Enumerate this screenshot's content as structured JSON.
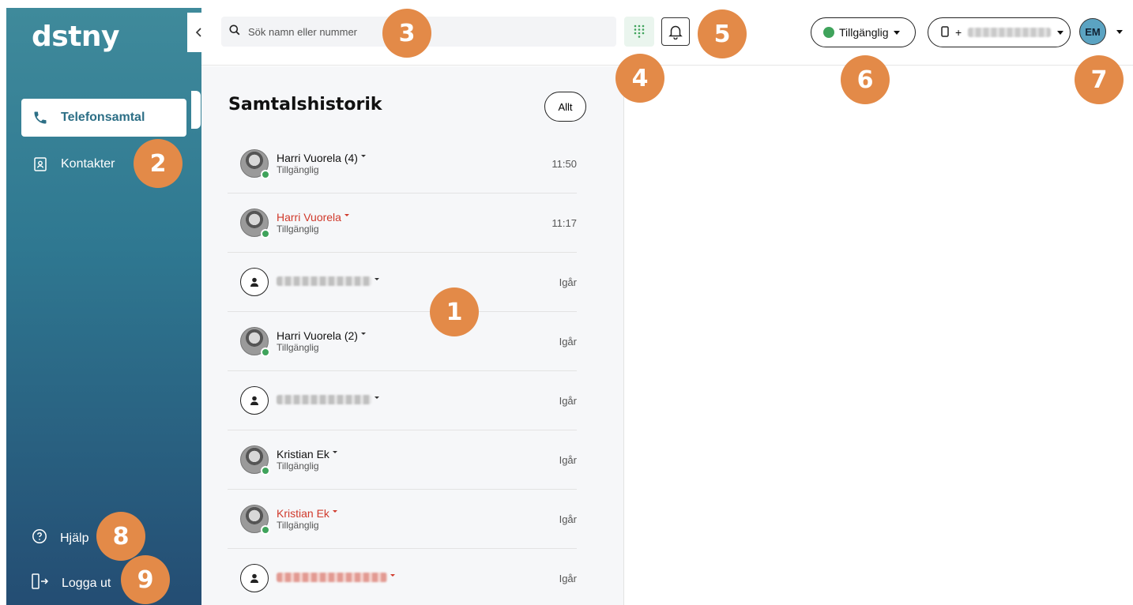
{
  "sidebar": {
    "logo": "dstny",
    "items": [
      {
        "label": "Telefonsamtal",
        "active": true,
        "icon": "phone-icon"
      },
      {
        "label": "Kontakter",
        "active": false,
        "icon": "contacts-icon"
      }
    ],
    "bottom": [
      {
        "label": "Hjälp",
        "icon": "help-icon"
      },
      {
        "label": "Logga ut",
        "icon": "logout-icon"
      }
    ]
  },
  "topbar": {
    "search_placeholder": "Sök namn eller nummer",
    "status_label": "Tillgänglig",
    "status_color": "#3fa35b",
    "phone_prefix": "+",
    "avatar_initials": "EM"
  },
  "history": {
    "title": "Samtalshistorik",
    "filter_label": "Allt",
    "calls": [
      {
        "name": "Harri Vuorela (4)",
        "status": "Tillgänglig",
        "time": "11:50",
        "missed": false,
        "avatar": "photo"
      },
      {
        "name": "Harri Vuorela",
        "status": "Tillgänglig",
        "time": "11:17",
        "missed": true,
        "avatar": "photo"
      },
      {
        "name": "",
        "status": "",
        "time": "Igår",
        "missed": false,
        "avatar": "generic"
      },
      {
        "name": "Harri Vuorela (2)",
        "status": "Tillgänglig",
        "time": "Igår",
        "missed": false,
        "avatar": "photo"
      },
      {
        "name": "",
        "status": "",
        "time": "Igår",
        "missed": false,
        "avatar": "generic"
      },
      {
        "name": "Kristian Ek",
        "status": "Tillgänglig",
        "time": "Igår",
        "missed": false,
        "avatar": "photo"
      },
      {
        "name": "Kristian Ek",
        "status": "Tillgänglig",
        "time": "Igår",
        "missed": true,
        "avatar": "photo"
      },
      {
        "name": "",
        "status": "",
        "time": "Igår",
        "missed": true,
        "avatar": "generic"
      }
    ]
  },
  "callouts": [
    "1",
    "2",
    "3",
    "4",
    "5",
    "6",
    "7",
    "8",
    "9"
  ],
  "colors": {
    "accent": "#2d6f86",
    "badge": "#e38a48",
    "missed": "#d0392b",
    "online": "#3fa35b"
  }
}
